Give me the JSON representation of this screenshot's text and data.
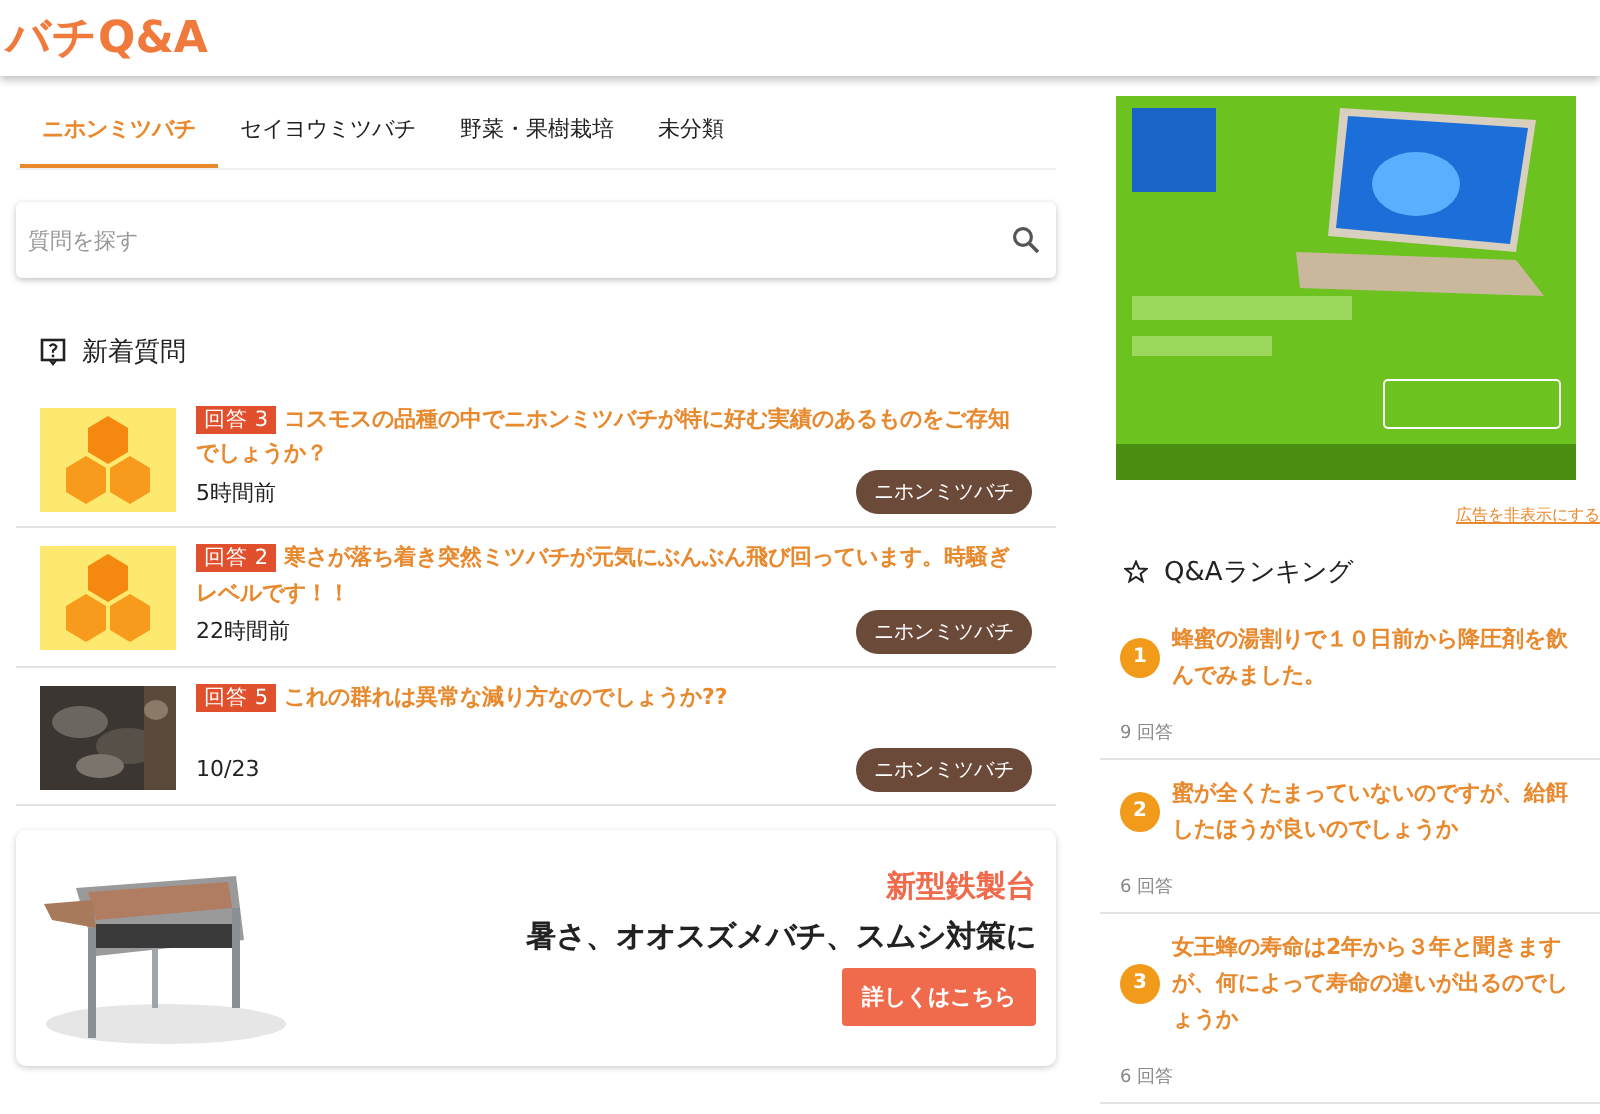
{
  "header": {
    "logo": "バチQ&A"
  },
  "tabs": [
    {
      "label": "ニホンミツバチ",
      "selected": true
    },
    {
      "label": "セイヨウミツバチ",
      "selected": false
    },
    {
      "label": "野菜・果樹栽培",
      "selected": false
    },
    {
      "label": "未分類",
      "selected": false
    }
  ],
  "search": {
    "placeholder": "質問を探す"
  },
  "new_questions": {
    "title": "新着質問",
    "items": [
      {
        "kind": "icon",
        "answers": "回答 3",
        "title": "コスモスの品種の中でニホンミツバチが特に好む実績のあるものをご存知でしょうか？",
        "time": "5時間前",
        "tag": "ニホンミツバチ"
      },
      {
        "kind": "icon",
        "answers": "回答 2",
        "title": "寒さが落ち着き突然ミツバチが元気にぶんぶん飛び回っています。時騒ぎレベルです！！",
        "time": "22時間前",
        "tag": "ニホンミツバチ"
      },
      {
        "kind": "picture",
        "answers": "回答 5",
        "title": "これの群れは異常な減り方なのでしょうか??",
        "time": "10/23",
        "tag": "ニホンミツバチ"
      }
    ]
  },
  "promo": {
    "title": "新型鉄製台",
    "subtitle": "暑さ、オオスズメバチ、スムシ対策に",
    "button": "詳しくはこちら"
  },
  "ad": {
    "kind": "picture",
    "hide_link": "広告を非表示にする"
  },
  "ranking": {
    "title": "Q&Aランキング",
    "items": [
      {
        "rank": "1",
        "title": "蜂蜜の湯割りで１０日前から降圧剤を飲んでみました。",
        "answers": "9 回答"
      },
      {
        "rank": "2",
        "title": "蜜が全くたまっていないのですが、給餌したほうが良いのでしょうか",
        "answers": "6 回答"
      },
      {
        "rank": "3",
        "title": "女王蜂の寿命は2年から３年と聞きますが、何によって寿命の違いが出るのでしょうか",
        "answers": "6 回答"
      }
    ]
  }
}
